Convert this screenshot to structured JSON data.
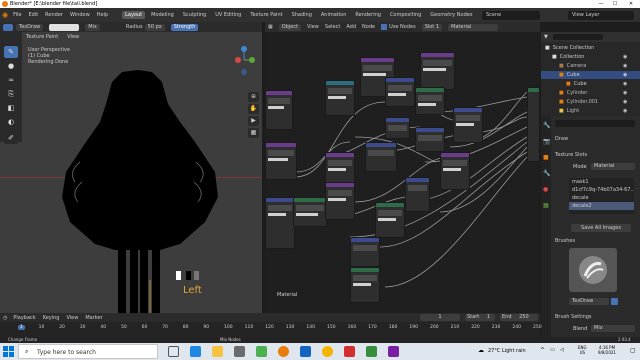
{
  "window": {
    "title": "Blender* [E:\\blender file\\tail.blend]"
  },
  "menubar": {
    "menus": [
      "File",
      "Edit",
      "Render",
      "Window",
      "Help"
    ],
    "workspaces": [
      "Layout",
      "Modeling",
      "Sculpting",
      "UV Editing",
      "Texture Paint",
      "Shading",
      "Animation",
      "Rendering",
      "Compositing",
      "Geometry Nodes",
      "Scripting"
    ],
    "active_workspace": "Layout",
    "scene": "Scene",
    "view_layer": "View Layer"
  },
  "viewport": {
    "brush_name": "TexDraw",
    "blend_mode": "Mix",
    "radius_label": "Radius",
    "radius_value": "50 px",
    "strength_label": "Strength",
    "mode": "Texture Paint",
    "view_menu": "View",
    "info_lines": [
      "User Perspective",
      "(1) Cube",
      "Rendering Done"
    ],
    "view_label": "Left"
  },
  "node_editor": {
    "header_items": [
      "Object",
      "View",
      "Select",
      "Add",
      "Node"
    ],
    "use_nodes_label": "Use Nodes",
    "slot": "Slot 1",
    "material": "Material",
    "footer_label": "Material"
  },
  "outliner": {
    "items": [
      {
        "label": "Scene Collection",
        "level": 0
      },
      {
        "label": "Collection",
        "level": 1
      },
      {
        "label": "Camera",
        "level": 2
      },
      {
        "label": "Cube",
        "level": 2,
        "selected": true
      },
      {
        "label": "Cube",
        "level": 3
      },
      {
        "label": "Cylinder",
        "level": 2
      },
      {
        "label": "Cylinder.001",
        "level": 2
      },
      {
        "label": "Light",
        "level": 2
      }
    ]
  },
  "properties": {
    "tool_name": "Draw",
    "texture_slots_title": "Texture Slots",
    "mode_label": "Mode",
    "mode_value": "Material",
    "slots": [
      "mask1",
      "d1cf7c9q-74b07a34-67...",
      "decale",
      "decale2"
    ],
    "active_slot": "decale2",
    "save_button": "Save All Images",
    "brushes_title": "Brushes",
    "brush_field": "TexDraw",
    "brush_settings_title": "Brush Settings",
    "blend_label": "Blend",
    "blend_value": "Mix"
  },
  "timeline": {
    "menus": [
      "Playback",
      "Keying",
      "View",
      "Marker"
    ],
    "current_frame": "1",
    "start_label": "Start",
    "start": "1",
    "end_label": "End",
    "end": "250",
    "ticks": [
      "1",
      "10",
      "20",
      "30",
      "40",
      "50",
      "60",
      "70",
      "80",
      "90",
      "100",
      "110",
      "120",
      "130",
      "140",
      "150",
      "160",
      "170",
      "180",
      "190",
      "200",
      "210",
      "220",
      "230",
      "240",
      "250"
    ]
  },
  "statusbar": {
    "left": "Change Frame",
    "middle": "Mix Nodes",
    "version": "2.93.4"
  },
  "taskbar": {
    "search_placeholder": "Type here to search",
    "weather": "27°C  Light rain",
    "language": "ENG",
    "region": "US",
    "time": "4:16 PM",
    "date": "9/8/2021"
  },
  "colors": {
    "accent": "#4772b3",
    "blender_orange": "#e87d0d",
    "view_label": "#e5a23a",
    "node_green": "#2e6b47",
    "node_blue": "#3d4a8c",
    "node_purple": "#6a3d8c",
    "node_teal": "#2d6e7e"
  }
}
